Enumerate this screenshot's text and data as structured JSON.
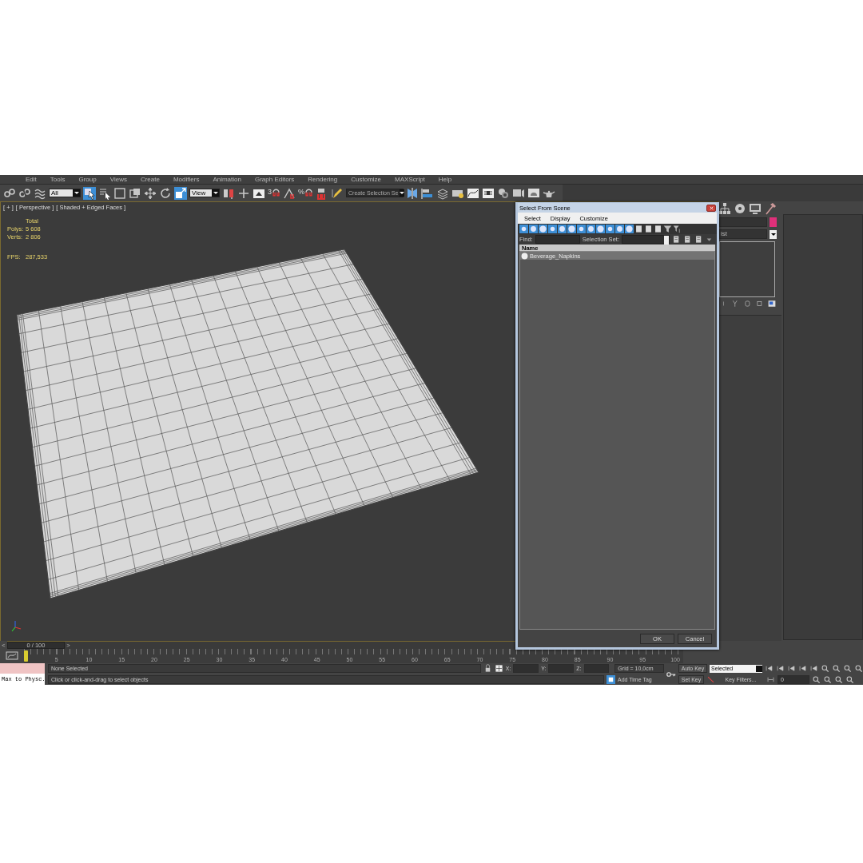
{
  "menu": [
    "Edit",
    "Tools",
    "Group",
    "Views",
    "Create",
    "Modifiers",
    "Animation",
    "Graph Editors",
    "Rendering",
    "Customize",
    "MAXScript",
    "Help"
  ],
  "toolbar": {
    "selection_filter": "All",
    "reference_coordinate": "View",
    "snap_label": "3",
    "percent_snap_label": "%",
    "named_selection": "Create Selection Se"
  },
  "viewport": {
    "labels": [
      "[ + ]",
      "[ Perspective ]",
      "[ Shaded + Edged Faces ]"
    ],
    "stats": {
      "header": "Total",
      "rows": [
        {
          "label": "Polys:",
          "value": "5 608"
        },
        {
          "label": "Verts:",
          "value": "2 806"
        }
      ],
      "fps_label": "FPS:",
      "fps_value": "287,533"
    }
  },
  "dialog": {
    "title": "Select From Scene",
    "menu": [
      "Select",
      "Display",
      "Customize"
    ],
    "find_label": "Find:",
    "selection_set_label": "Selection Set:",
    "column": "Name",
    "rows": [
      {
        "name": "Beverage_Napkins",
        "selected": true
      }
    ],
    "buttons": [
      "OK",
      "Cancel"
    ]
  },
  "command_panel": {
    "modifier_list": "ist"
  },
  "time_slider": {
    "prev": "<",
    "position": "0 / 100",
    "next": ">",
    "level": 0
  },
  "track_bar": {
    "ticks": [
      "5",
      "10",
      "15",
      "20",
      "25",
      "30",
      "35",
      "40",
      "45",
      "50",
      "55",
      "60",
      "65",
      "70",
      "75",
      "80",
      "85",
      "90",
      "95",
      "100"
    ]
  },
  "status": {
    "script_listener": "Max to Physc.",
    "selection": "None Selected",
    "prompt": "Click or click-and-drag to select objects",
    "x_label": "X:",
    "y_label": "Y:",
    "z_label": "Z:",
    "grid": "Grid = 10,0cm",
    "time_tag": "Add Time Tag",
    "auto_key": "Auto Key",
    "key_mode": "Selected",
    "set_key": "Set Key",
    "key_filters": "Key Filters...",
    "frame": "0"
  }
}
